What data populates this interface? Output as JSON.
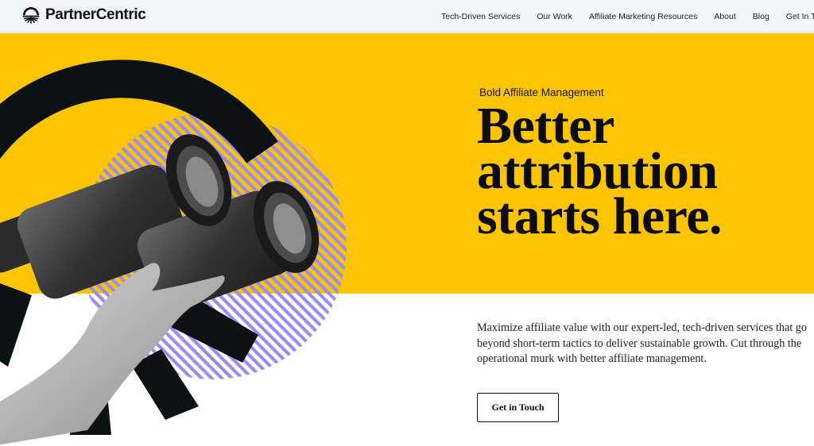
{
  "header": {
    "brand": "PartnerCentric",
    "nav": [
      {
        "label": "Tech-Driven Services"
      },
      {
        "label": "Our Work"
      },
      {
        "label": "Affiliate Marketing Resources"
      },
      {
        "label": "About"
      },
      {
        "label": "Blog"
      },
      {
        "label": "Get In Touch"
      }
    ]
  },
  "hero": {
    "eyebrow": "Bold Affiliate Management",
    "headline": [
      "Better",
      "attribution",
      "starts here."
    ],
    "description": "Maximize affiliate value with our expert-led, tech-driven services that go beyond short-term tactics to deliver sustainable growth. Cut through the operational murk with better affiliate management.",
    "cta_label": "Get in Touch",
    "image_alt": "hand holding binoculars"
  },
  "colors": {
    "brand_yellow": "#fcc500",
    "accent_purple": "#9b8cf0",
    "ink": "#0c1212",
    "header_bg": "#f3f5f8"
  }
}
